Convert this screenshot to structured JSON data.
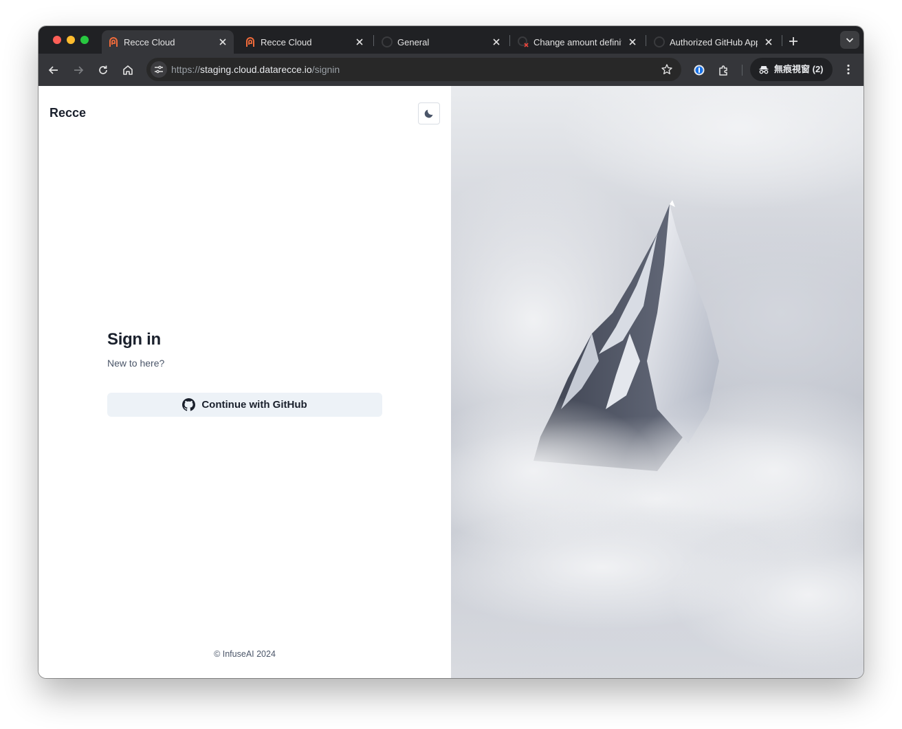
{
  "browser": {
    "tabs": [
      {
        "title": "Recce Cloud",
        "active": true,
        "favicon": "recce-logo-icon"
      },
      {
        "title": "Recce Cloud",
        "active": false,
        "favicon": "recce-logo-icon"
      },
      {
        "title": "General",
        "active": false,
        "favicon": "github-icon"
      },
      {
        "title": "Change amount definit",
        "active": false,
        "favicon": "github-error-icon"
      },
      {
        "title": "Authorized GitHub App",
        "active": false,
        "favicon": "github-icon"
      }
    ],
    "address": {
      "scheme": "https://",
      "host": "staging.cloud.datarecce.io",
      "path": "/signin"
    },
    "incognito_label": "無痕視窗 (2)",
    "colors": {
      "tabstrip": "#202124",
      "toolbar": "#35363a",
      "omnibox": "#282828"
    }
  },
  "page": {
    "brand": "Recce",
    "theme_toggle_icon": "moon-icon",
    "signin": {
      "title": "Sign in",
      "subtitle": "New to here?",
      "github_button": "Continue with GitHub"
    },
    "footer": "© InfuseAI 2024",
    "hero_image": "snowy-mountain-peak-in-clouds",
    "colors": {
      "button_bg": "#edf2f7",
      "text": "#1a202c",
      "muted": "#4a5568"
    }
  }
}
